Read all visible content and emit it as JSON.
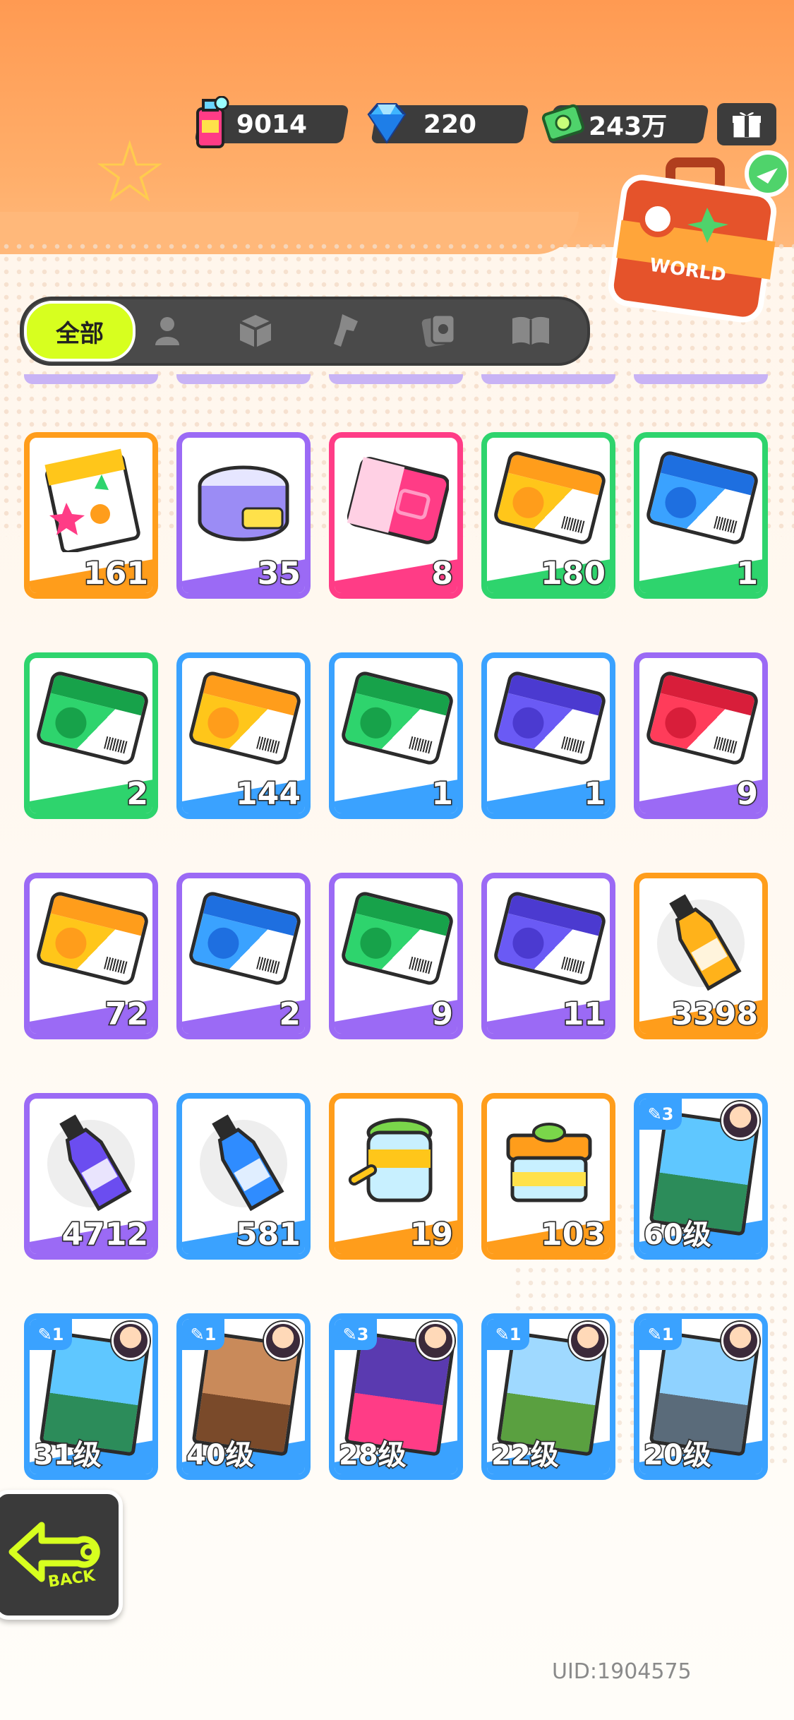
{
  "currency": {
    "spray": {
      "icon": "spray-can-icon",
      "value": "9014"
    },
    "gem": {
      "icon": "diamond-icon",
      "value": "220"
    },
    "cash": {
      "icon": "cash-icon",
      "value": "243万"
    },
    "gift_icon": "gift-box-icon"
  },
  "world_badge": {
    "label": "WORLD",
    "icon": "suitcase-icon"
  },
  "tabs": {
    "active_label": "全部",
    "icons": [
      "person-icon",
      "box-icon",
      "spray-gun-icon",
      "card-icon",
      "book-icon"
    ]
  },
  "items": [
    {
      "art": "sticker-pack",
      "color": "orange",
      "count": "161"
    },
    {
      "art": "cool-can",
      "color": "purple",
      "count": "35"
    },
    {
      "art": "pink-card",
      "color": "pink",
      "count": "8"
    },
    {
      "art": "ticket-yellow",
      "color": "green",
      "count": "180"
    },
    {
      "art": "ticket-blue",
      "color": "green",
      "count": "1"
    },
    {
      "art": "ticket-green",
      "color": "green",
      "count": "2"
    },
    {
      "art": "ticket-yellow",
      "color": "blue",
      "count": "144"
    },
    {
      "art": "ticket-green",
      "color": "blue",
      "count": "1"
    },
    {
      "art": "ticket-purple",
      "color": "blue",
      "count": "1"
    },
    {
      "art": "ticket-red",
      "color": "purple",
      "count": "9"
    },
    {
      "art": "ticket-yellow",
      "color": "purple",
      "count": "72"
    },
    {
      "art": "ticket-blue",
      "color": "purple",
      "count": "2"
    },
    {
      "art": "ticket-green",
      "color": "purple",
      "count": "9"
    },
    {
      "art": "ticket-purple",
      "color": "purple",
      "count": "11"
    },
    {
      "art": "color-bottle-orange",
      "color": "orange",
      "count": "3398"
    },
    {
      "art": "color-bottle-purple",
      "color": "purple",
      "count": "4712"
    },
    {
      "art": "color-bottle-blue",
      "color": "blue",
      "count": "581"
    },
    {
      "art": "paint-jar",
      "color": "orange",
      "count": "19"
    },
    {
      "art": "paint-box",
      "color": "orange",
      "count": "103"
    },
    {
      "art": "scene-motel",
      "color": "blue",
      "level": "60级",
      "rank": "3"
    },
    {
      "art": "scene-motel",
      "color": "blue",
      "level": "31级",
      "rank": "1"
    },
    {
      "art": "scene-sphinx",
      "color": "blue",
      "level": "40级",
      "rank": "1"
    },
    {
      "art": "scene-tower",
      "color": "blue",
      "level": "28级",
      "rank": "3"
    },
    {
      "art": "scene-church",
      "color": "blue",
      "level": "22级",
      "rank": "1"
    },
    {
      "art": "scene-moai",
      "color": "blue",
      "level": "20级",
      "rank": "1"
    }
  ],
  "back": {
    "label": "BACK",
    "icon": "back-arrow-icon"
  },
  "uid": "UID:1904575"
}
